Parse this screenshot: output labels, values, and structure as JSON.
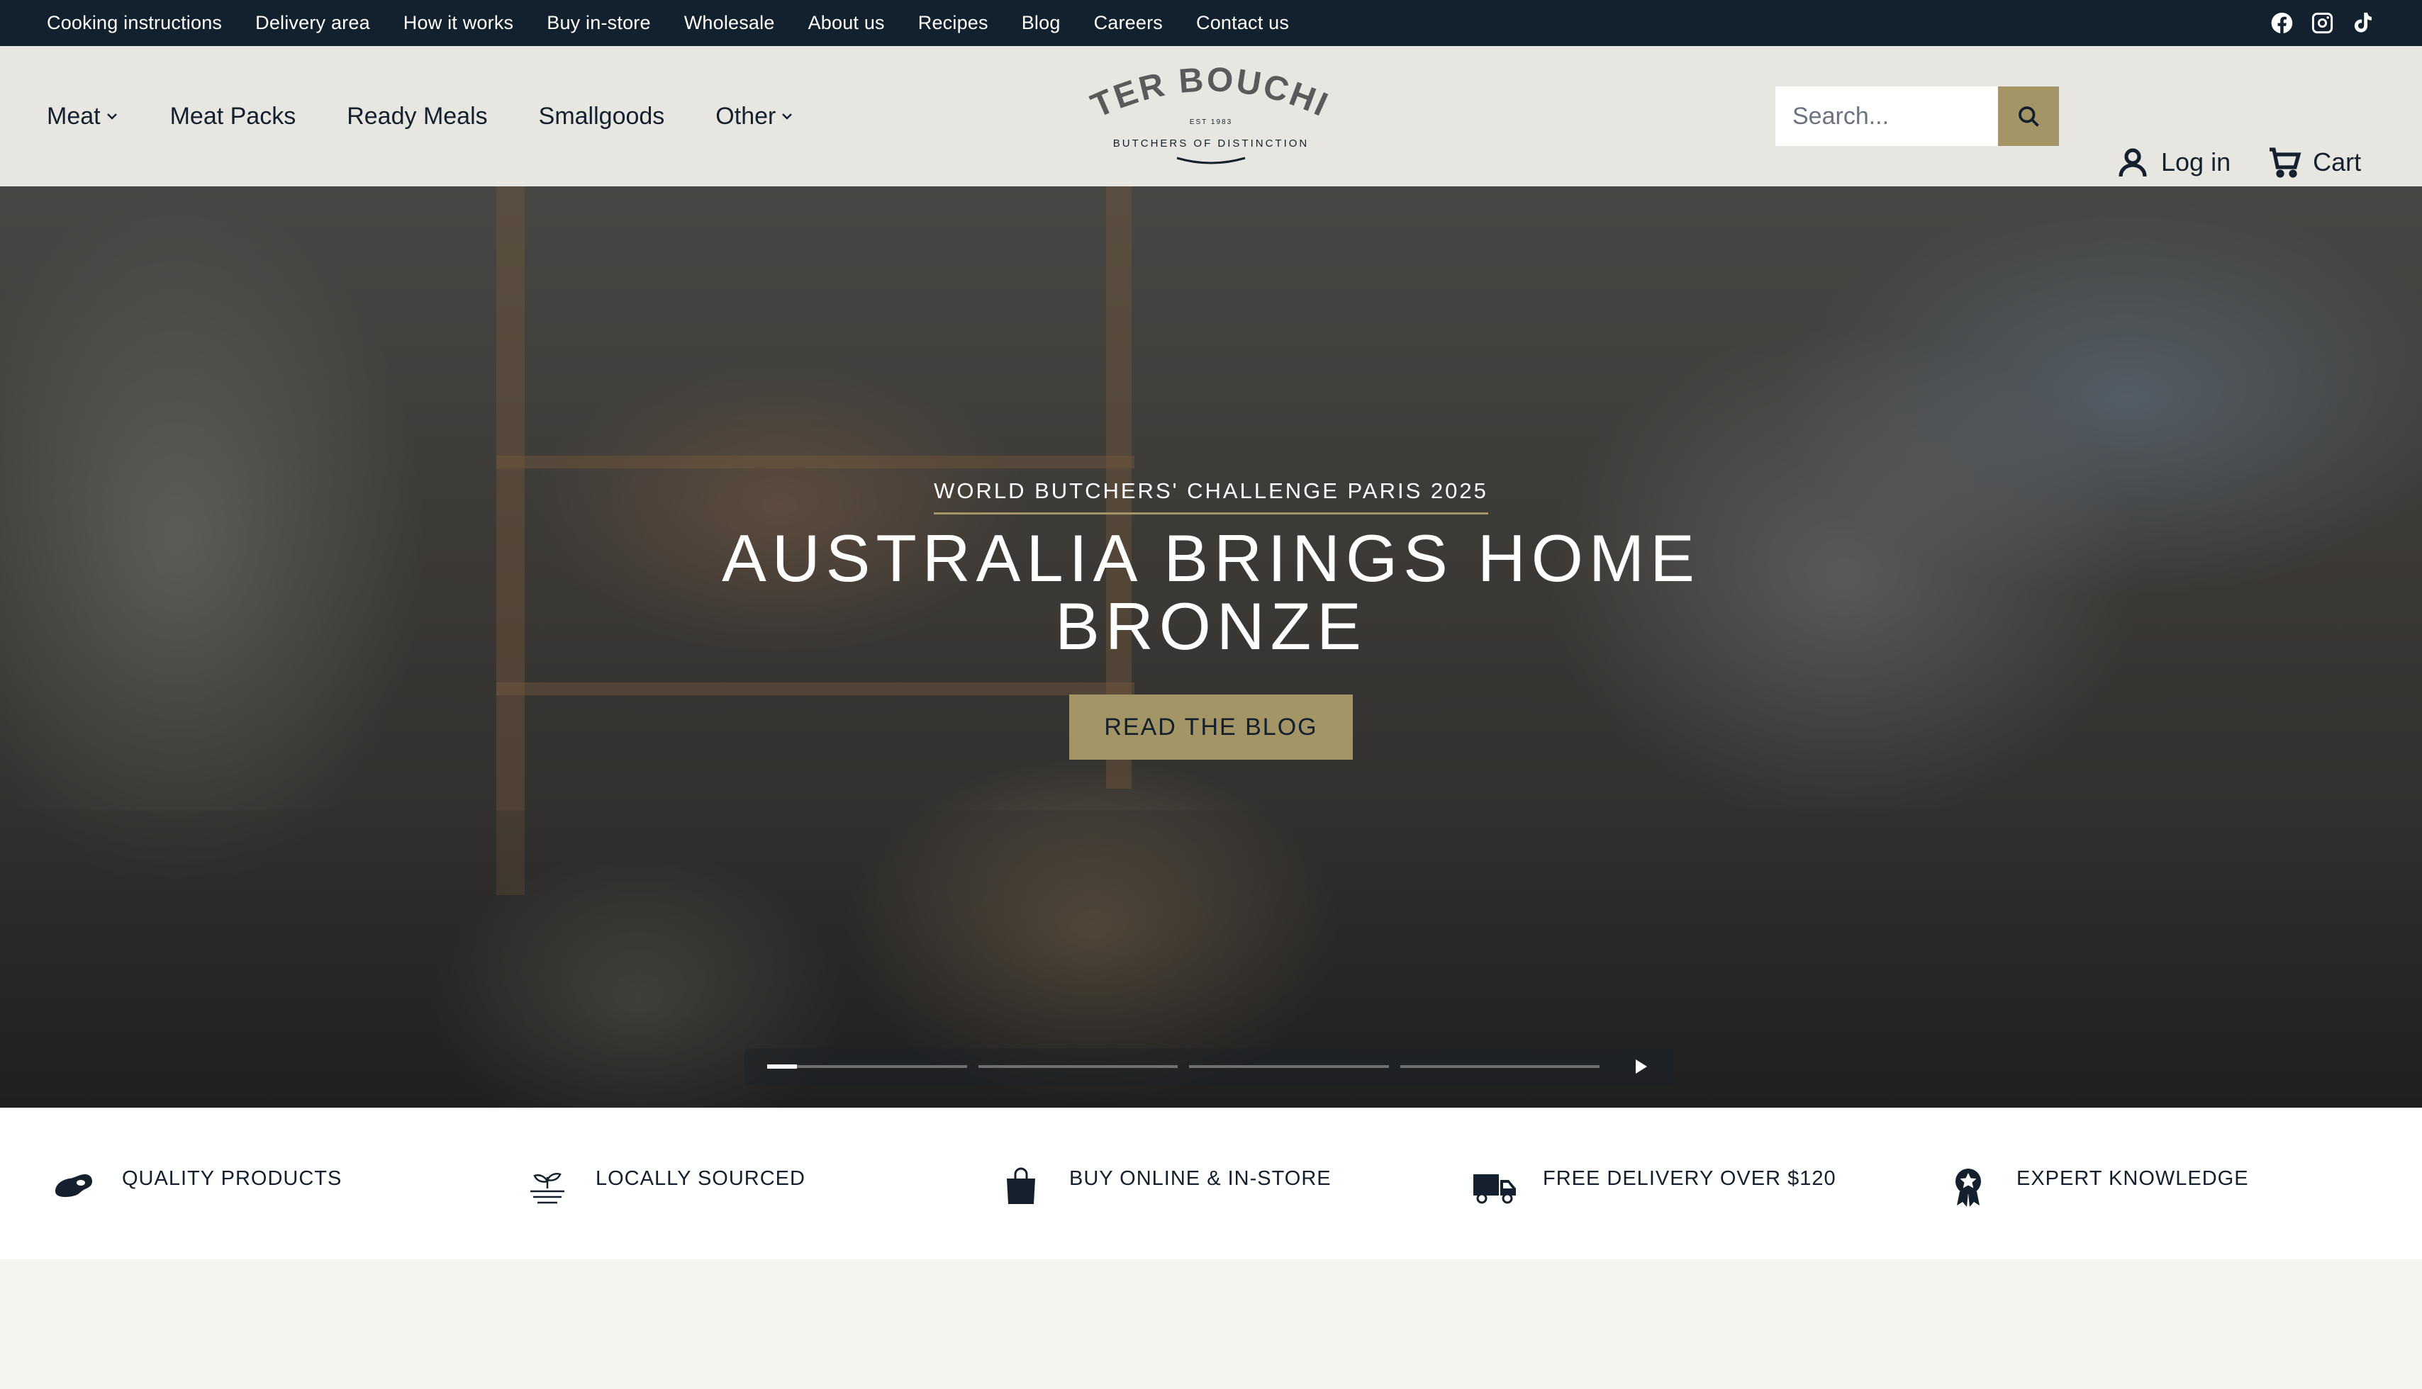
{
  "topbar": {
    "links": [
      "Cooking instructions",
      "Delivery area",
      "How it works",
      "Buy in-store",
      "Wholesale",
      "About us",
      "Recipes",
      "Blog",
      "Careers",
      "Contact us"
    ],
    "social": [
      "facebook-icon",
      "instagram-icon",
      "tiktok-icon"
    ]
  },
  "header": {
    "nav": [
      "Meat",
      "Meat Packs",
      "Ready Meals",
      "Smallgoods",
      "Other"
    ],
    "logo": {
      "name": "PETER BOUCHIER",
      "est": "EST 1983",
      "tagline": "BUTCHERS OF DISTINCTION"
    },
    "search": {
      "placeholder": "Search..."
    },
    "login_label": "Log in",
    "cart_label": "Cart"
  },
  "hero": {
    "eyebrow": "WORLD BUTCHERS' CHALLENGE PARIS 2025",
    "headline": "AUSTRALIA BRINGS HOME BRONZE",
    "cta": "READ THE BLOG",
    "slides": {
      "count": 4,
      "active": 1,
      "active_progress": 0.15
    }
  },
  "features": [
    {
      "label": "QUALITY PRODUCTS",
      "icon": "steak-icon"
    },
    {
      "label": "LOCALLY SOURCED",
      "icon": "sprout-icon"
    },
    {
      "label": "BUY ONLINE & IN-STORE",
      "icon": "shopping-bag-icon"
    },
    {
      "label": "FREE DELIVERY OVER $120",
      "icon": "delivery-truck-icon"
    },
    {
      "label": "EXPERT KNOWLEDGE",
      "icon": "award-badge-icon"
    }
  ],
  "colors": {
    "navy": "#13202e",
    "gold": "#a39566",
    "header_bg": "#e7e6e1"
  }
}
